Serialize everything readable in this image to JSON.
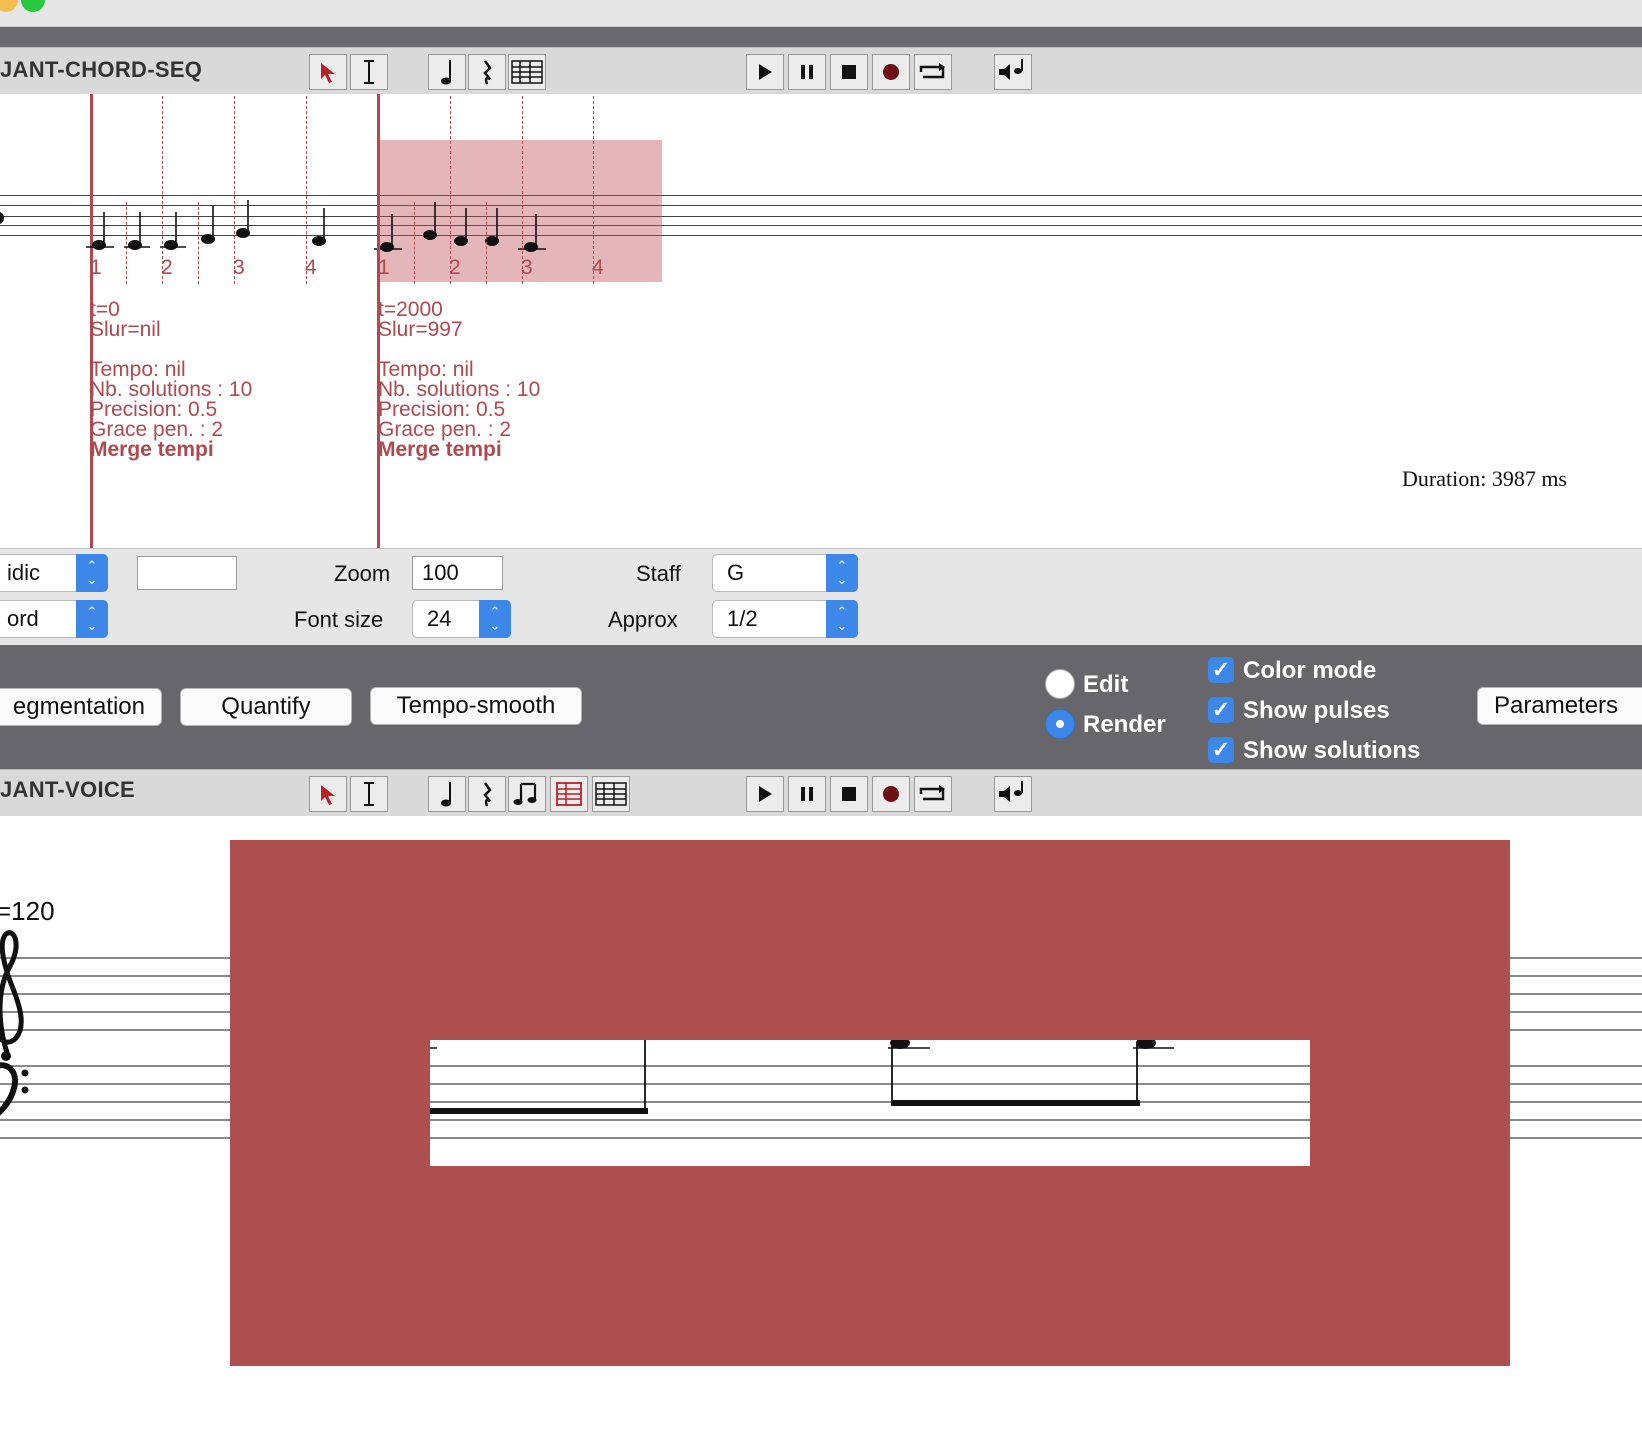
{
  "window": {
    "traffic_lights": [
      "#f5bd4f",
      "#29c940"
    ]
  },
  "panel1": {
    "title": "JANT-CHORD-SEQ",
    "transport": [
      "play-icon",
      "pause-icon",
      "stop-icon",
      "record-icon",
      "loop-icon",
      "speaker-icon"
    ],
    "groups": [
      {
        "t_label": "t=0",
        "slur_label": "Slur=nil",
        "tempo": "Tempo: nil",
        "nb_solutions": "Nb. solutions : 10",
        "precision": "Precision: 0.5",
        "grace": "Grace pen. : 2",
        "merge": "Merge tempi",
        "pulses": [
          "1",
          "2",
          "3",
          "4"
        ]
      },
      {
        "t_label": "t=2000",
        "slur_label": "Slur=997",
        "tempo": "Tempo: nil",
        "nb_solutions": "Nb. solutions : 10",
        "precision": "Precision: 0.5",
        "grace": "Grace pen. : 2",
        "merge": "Merge tempi",
        "pulses": [
          "1",
          "2",
          "3",
          "4"
        ]
      }
    ],
    "duration": "Duration: 3987 ms"
  },
  "controls": {
    "select1": "idic",
    "select2": "ord",
    "zoom_label": "Zoom",
    "zoom_value": "100",
    "fontsize_label": "Font size",
    "fontsize_value": "24",
    "staff_label": "Staff",
    "staff_value": "G",
    "approx_label": "Approx",
    "approx_value": "1/2"
  },
  "actions": {
    "segmentation": "egmentation",
    "quantify": "Quantify",
    "tempo_smooth": "Tempo-smooth",
    "edit": "Edit",
    "render": "Render",
    "mode_selected": "Render",
    "color_mode": "Color mode",
    "show_pulses": "Show pulses",
    "show_solutions": "Show solutions",
    "parameters": "Parameters"
  },
  "panel2": {
    "title": "JANT-VOICE",
    "tempo": "=120"
  },
  "colors": {
    "accent": "#3c87e8",
    "highlight": "#ad4f4f",
    "pulse": "#b04a4e"
  }
}
